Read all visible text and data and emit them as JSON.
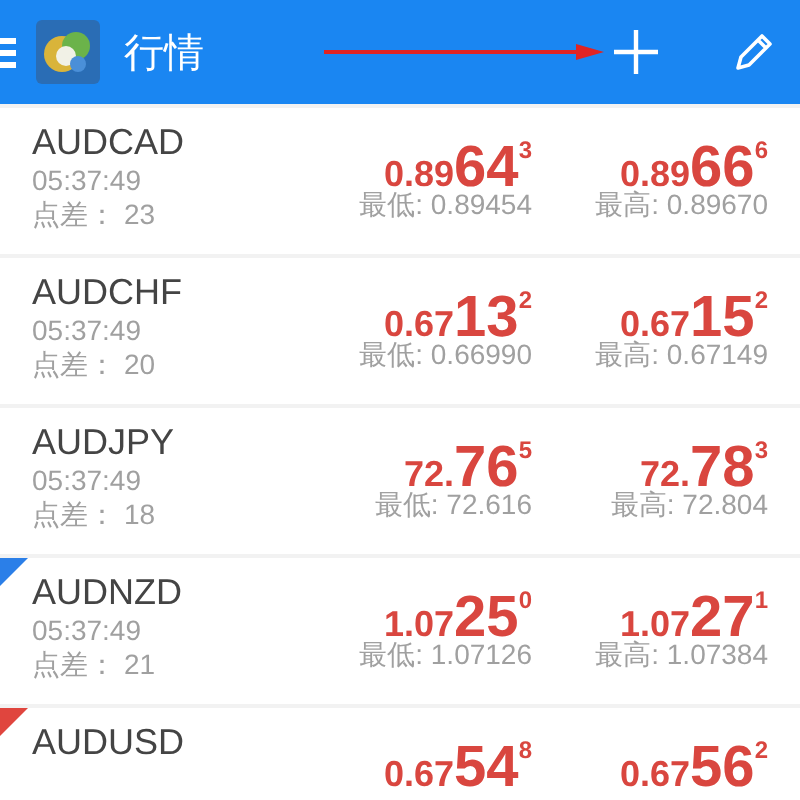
{
  "header": {
    "title": "行情"
  },
  "rows": [
    {
      "symbol": "AUDCAD",
      "time": "05:37:49",
      "spread_label": "点差：",
      "spread": "23",
      "bid": {
        "prefix": "0.89",
        "big": "64",
        "pip": "3"
      },
      "ask": {
        "prefix": "0.89",
        "big": "66",
        "pip": "6"
      },
      "low": "最低: 0.89454",
      "high": "最高: 0.89670"
    },
    {
      "symbol": "AUDCHF",
      "time": "05:37:49",
      "spread_label": "点差：",
      "spread": "20",
      "bid": {
        "prefix": "0.67",
        "big": "13",
        "pip": "2"
      },
      "ask": {
        "prefix": "0.67",
        "big": "15",
        "pip": "2"
      },
      "low": "最低: 0.66990",
      "high": "最高: 0.67149"
    },
    {
      "symbol": "AUDJPY",
      "time": "05:37:49",
      "spread_label": "点差：",
      "spread": "18",
      "bid": {
        "prefix": "72.",
        "big": "76",
        "pip": "5"
      },
      "ask": {
        "prefix": "72.",
        "big": "78",
        "pip": "3"
      },
      "low": "最低: 72.616",
      "high": "最高: 72.804"
    },
    {
      "symbol": "AUDNZD",
      "color": "#2b7fe8",
      "time": "05:37:49",
      "spread_label": "点差：",
      "spread": "21",
      "bid": {
        "prefix": "1.07",
        "big": "25",
        "pip": "0"
      },
      "ask": {
        "prefix": "1.07",
        "big": "27",
        "pip": "1"
      },
      "low": "最低: 1.07126",
      "high": "最高: 1.07384"
    },
    {
      "symbol": "AUDUSD",
      "color": "#e0453e",
      "bid": {
        "prefix": "0.67",
        "big": "54",
        "pip": "8"
      },
      "ask": {
        "prefix": "0.67",
        "big": "56",
        "pip": "2"
      }
    }
  ]
}
